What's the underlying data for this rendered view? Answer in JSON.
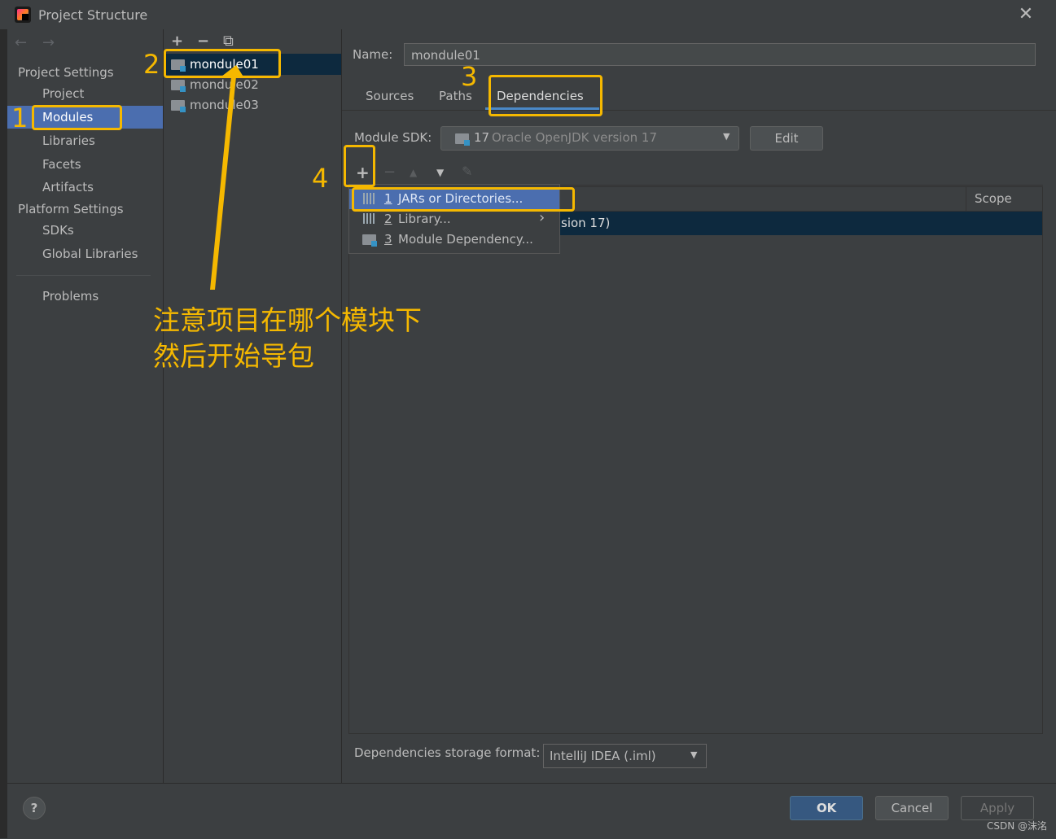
{
  "window": {
    "title": "Project Structure",
    "close_glyph": "✕"
  },
  "nav": {
    "back_glyph": "←",
    "forward_glyph": "→",
    "project_settings_header": "Project Settings",
    "platform_settings_header": "Platform Settings",
    "items": {
      "project": "Project",
      "modules": "Modules",
      "libraries": "Libraries",
      "facets": "Facets",
      "artifacts": "Artifacts",
      "sdks": "SDKs",
      "global_libraries": "Global Libraries",
      "problems": "Problems"
    },
    "selected": "Modules"
  },
  "modules_toolbar": {
    "add": "+",
    "remove": "−",
    "copy": "⧉"
  },
  "modules": [
    "mondule01",
    "mondule02",
    "mondule03"
  ],
  "selected_module": "mondule01",
  "detail": {
    "name_label": "Name:",
    "name_value": "mondule01",
    "tabs": [
      "Sources",
      "Paths",
      "Dependencies"
    ],
    "active_tab": "Dependencies",
    "module_sdk_label": "Module SDK:",
    "module_sdk_value_num": "17",
    "module_sdk_value_text": "Oracle OpenJDK version 17",
    "edit_button": "Edit",
    "dep_toolbar": {
      "add": "+",
      "remove": "−",
      "up": "▲",
      "down": "▼",
      "edit": "✎"
    },
    "table": {
      "scope_header": "Scope",
      "row_visible_text": "sion 17)"
    },
    "storage_format_label": "Dependencies storage format:",
    "storage_format_value": "IntelliJ IDEA (.iml)"
  },
  "add_popup": {
    "items": [
      {
        "num": "1",
        "label": "JARs or Directories...",
        "selected": true,
        "has_submenu": false
      },
      {
        "num": "2",
        "label": "Library...",
        "selected": false,
        "has_submenu": true
      },
      {
        "num": "3",
        "label": "Module Dependency...",
        "selected": false,
        "has_submenu": false
      }
    ],
    "submenu_glyph": "›"
  },
  "footer": {
    "help": "?",
    "ok": "OK",
    "cancel": "Cancel",
    "apply": "Apply"
  },
  "annotations": {
    "steps": [
      "1",
      "2",
      "3",
      "4"
    ],
    "note_line1": "注意项目在哪个模块下",
    "note_line2": "然后开始导包",
    "color": "#f5b800"
  },
  "watermark": "CSDN @沫洺",
  "colors": {
    "background": "#3c3f41",
    "selection": "#4b6eaf",
    "list_selection_unfocused": "#0d293e",
    "ok_button": "#365880",
    "annotation": "#f5b800"
  }
}
